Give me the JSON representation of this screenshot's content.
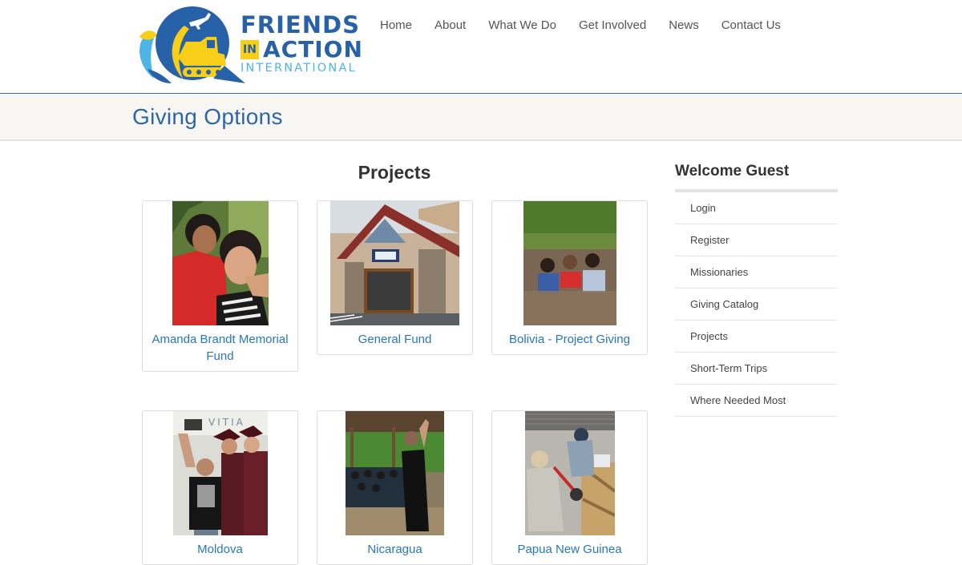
{
  "logo": {
    "line1": "FRIENDS",
    "in": "IN",
    "action": "ACTION",
    "line3": "INTERNATIONAL",
    "colors": {
      "primary": "#2761a8",
      "accent": "#f8cf18",
      "light": "#4cb5e6"
    }
  },
  "nav": {
    "items": [
      {
        "label": "Home"
      },
      {
        "label": "About"
      },
      {
        "label": "What We Do"
      },
      {
        "label": "Get Involved"
      },
      {
        "label": "News"
      },
      {
        "label": "Contact Us"
      }
    ]
  },
  "page": {
    "title": "Giving Options"
  },
  "main": {
    "heading": "Projects",
    "cards": [
      {
        "label": "Amanda Brandt Memorial Fund",
        "image": "woman-and-child-photo"
      },
      {
        "label": "General Fund",
        "image": "office-building-photo"
      },
      {
        "label": "Bolivia - Project Giving",
        "image": "river-baptism-photo"
      },
      {
        "label": "Moldova",
        "image": "graduates-selfie-photo"
      },
      {
        "label": "Nicaragua",
        "image": "outdoor-gathering-photo"
      },
      {
        "label": "Papua New Guinea",
        "image": "machinery-repair-photo"
      }
    ]
  },
  "sidebar": {
    "welcome": "Welcome Guest",
    "items": [
      {
        "label": "Login"
      },
      {
        "label": "Register"
      },
      {
        "label": "Missionaries"
      },
      {
        "label": "Giving Catalog"
      },
      {
        "label": "Projects"
      },
      {
        "label": "Short-Term Trips"
      },
      {
        "label": "Where Needed Most"
      }
    ]
  }
}
